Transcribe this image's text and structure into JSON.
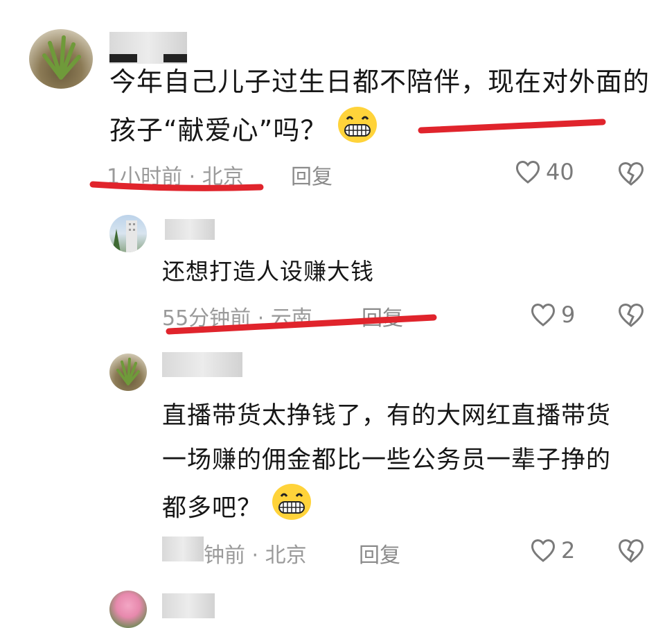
{
  "comments": [
    {
      "text_line1": "今年自己儿子过生日都不陪伴，现在对外面的",
      "text_line2": "孩子“献爱心”吗？",
      "emoji": "grinning-emoji",
      "time": "1小时前 · 北京",
      "reply_label": "回复",
      "likes": "40"
    },
    {
      "text": "还想打造人设赚大钱",
      "time": "55分钟前 · 云南",
      "reply_label": "回复",
      "likes": "9"
    },
    {
      "text_line1": "直播带货太挣钱了，有的大网红直播带货",
      "text_line2": "一场赚的佣金都比一些公务员一辈子挣的",
      "text_line3": "都多吧？",
      "emoji": "grinning-emoji",
      "time": "钟前 · 北京",
      "reply_label": "回复",
      "likes": "2"
    }
  ],
  "colors": {
    "annotation_red": "#e0242c",
    "meta_gray": "#9a9a9a"
  },
  "icons": [
    "heart-outline-icon",
    "broken-heart-icon",
    "grinning-emoji"
  ]
}
